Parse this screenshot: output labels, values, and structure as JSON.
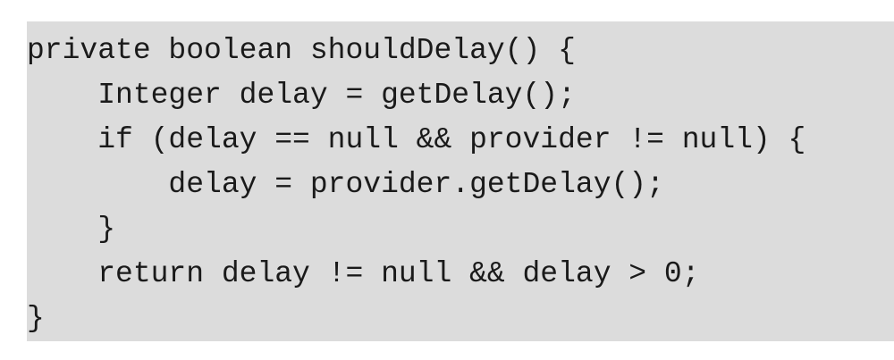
{
  "code": {
    "lines": [
      "private boolean shouldDelay() {",
      "    Integer delay = getDelay();",
      "    if (delay == null && provider != null) {",
      "        delay = provider.getDelay();",
      "    }",
      "    return delay != null && delay > 0;",
      "}"
    ]
  }
}
